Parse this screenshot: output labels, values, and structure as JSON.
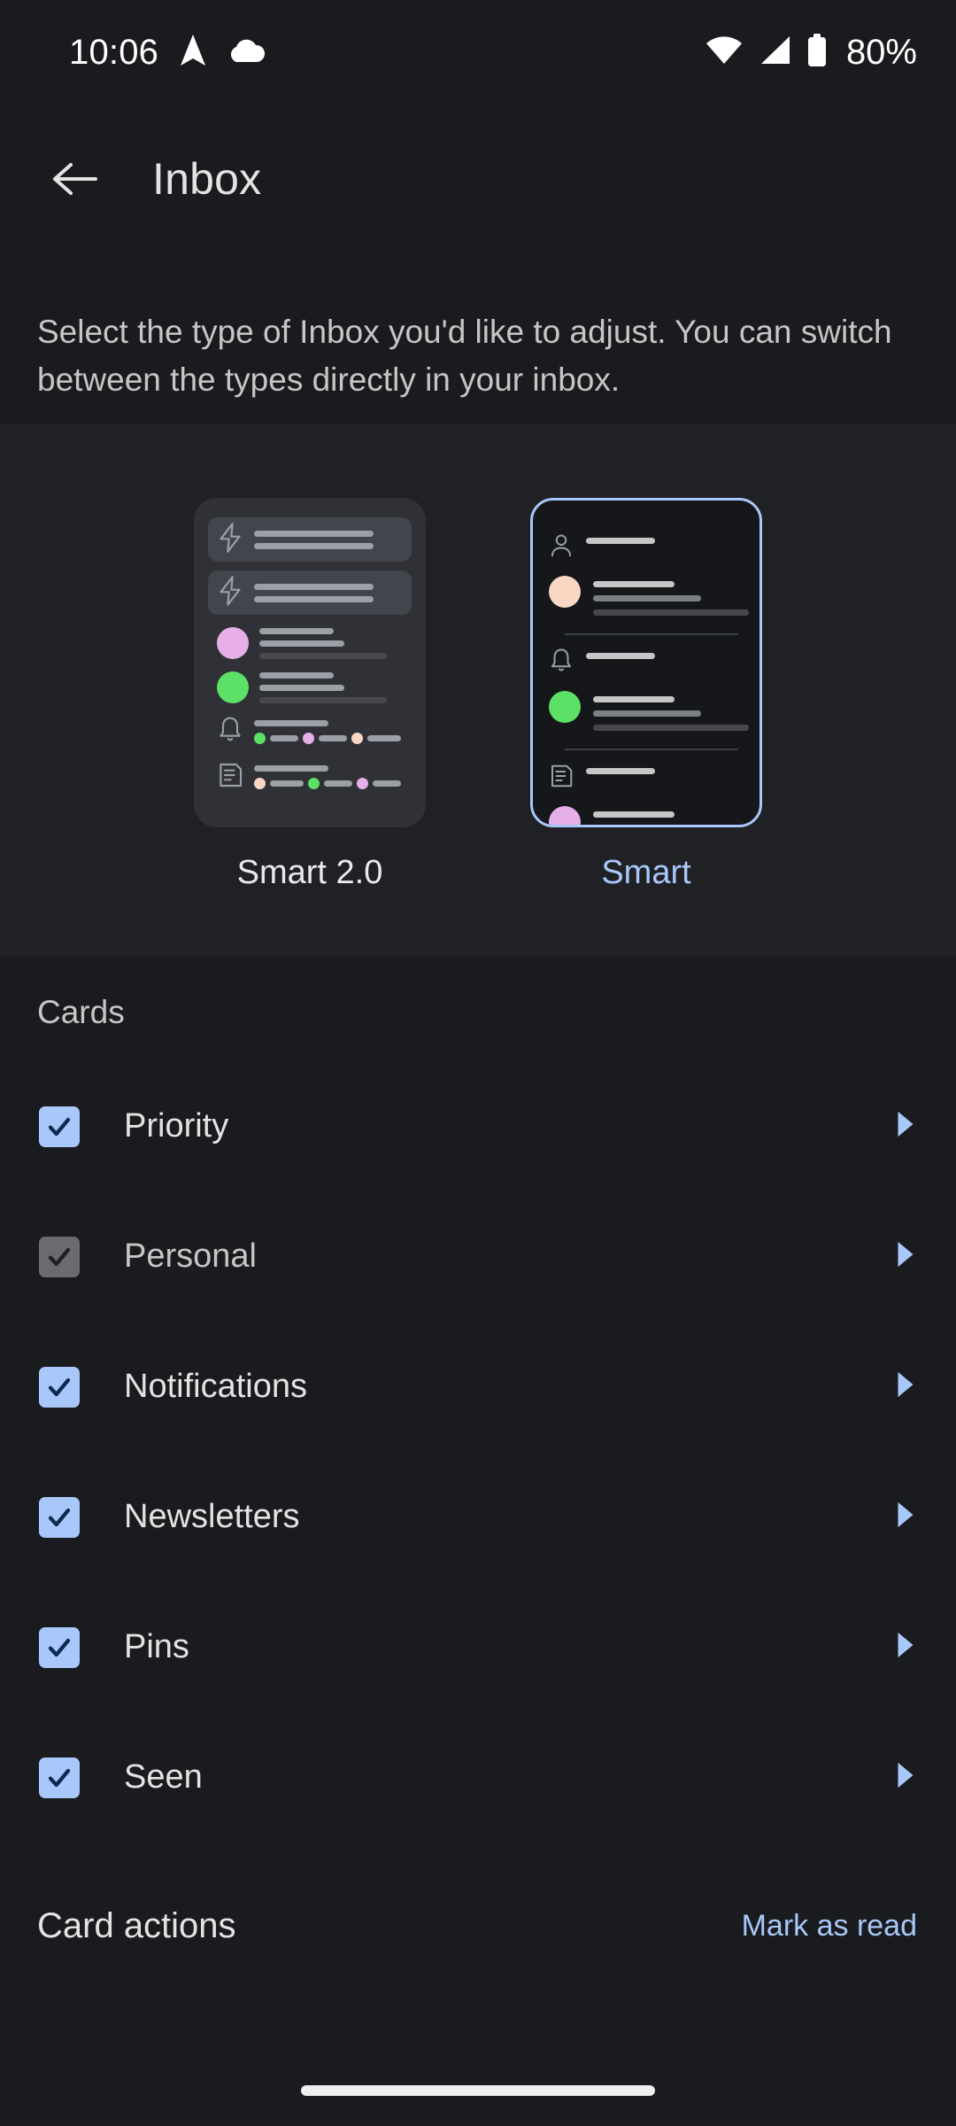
{
  "status_bar": {
    "time": "10:06",
    "battery_percent": "80%",
    "left_icons": [
      "navigation-arrow-icon",
      "cloud-icon"
    ],
    "right_icons": [
      "wifi-icon",
      "cellular-signal-icon",
      "battery-icon"
    ]
  },
  "app_bar": {
    "back_icon": "back-arrow-icon",
    "title": "Inbox"
  },
  "description": {
    "text": "Select the type of Inbox you'd like to adjust. You can switch between the types directly in your inbox."
  },
  "inbox_types": [
    {
      "id": "smart-2-0",
      "label": "Smart 2.0",
      "selected": false,
      "preview": {
        "rows": [
          {
            "icon": "lightning-bolt-icon",
            "style": "pill"
          },
          {
            "icon": "lightning-bolt-icon",
            "style": "pill"
          },
          {
            "avatar_color": "#e6afe8",
            "style": "avatar"
          },
          {
            "avatar_color": "#5ce065",
            "style": "avatar"
          },
          {
            "icon": "bell-icon",
            "style": "icon-chips",
            "chip_colors": [
              "#5ce065",
              "#e6afe8",
              "#fad7c3"
            ]
          },
          {
            "icon": "document-icon",
            "style": "icon-chips",
            "chip_colors": [
              "#fad7c3",
              "#5ce065",
              "#e6afe8"
            ]
          }
        ]
      }
    },
    {
      "id": "smart",
      "label": "Smart",
      "selected": true,
      "preview": {
        "groups": [
          {
            "icon": "person-icon",
            "avatar_color": "#fad7c3"
          },
          {
            "icon": "bell-icon",
            "avatar_color": "#5ce065"
          },
          {
            "icon": "document-icon",
            "avatar_color": "#e6afe8"
          }
        ]
      }
    }
  ],
  "cards": {
    "heading": "Cards",
    "items": [
      {
        "label": "Priority",
        "checked": true,
        "enabled": true,
        "chevron": "chevron-right-icon"
      },
      {
        "label": "Personal",
        "checked": true,
        "enabled": false,
        "chevron": "chevron-right-icon"
      },
      {
        "label": "Notifications",
        "checked": true,
        "enabled": true,
        "chevron": "chevron-right-icon"
      },
      {
        "label": "Newsletters",
        "checked": true,
        "enabled": true,
        "chevron": "chevron-right-icon"
      },
      {
        "label": "Pins",
        "checked": true,
        "enabled": true,
        "chevron": "chevron-right-icon"
      },
      {
        "label": "Seen",
        "checked": true,
        "enabled": true,
        "chevron": "chevron-right-icon"
      }
    ]
  },
  "card_actions": {
    "label": "Card actions",
    "action_label": "Mark as read"
  },
  "colors": {
    "accent": "#a8c7fa",
    "background": "#1a1b1e",
    "band_background": "#202124",
    "text_primary": "#e3e3e3",
    "text_secondary": "#c4c7c5",
    "checkbox_on": "#a8c7fa",
    "checkbox_disabled": "#6b6b6f"
  }
}
